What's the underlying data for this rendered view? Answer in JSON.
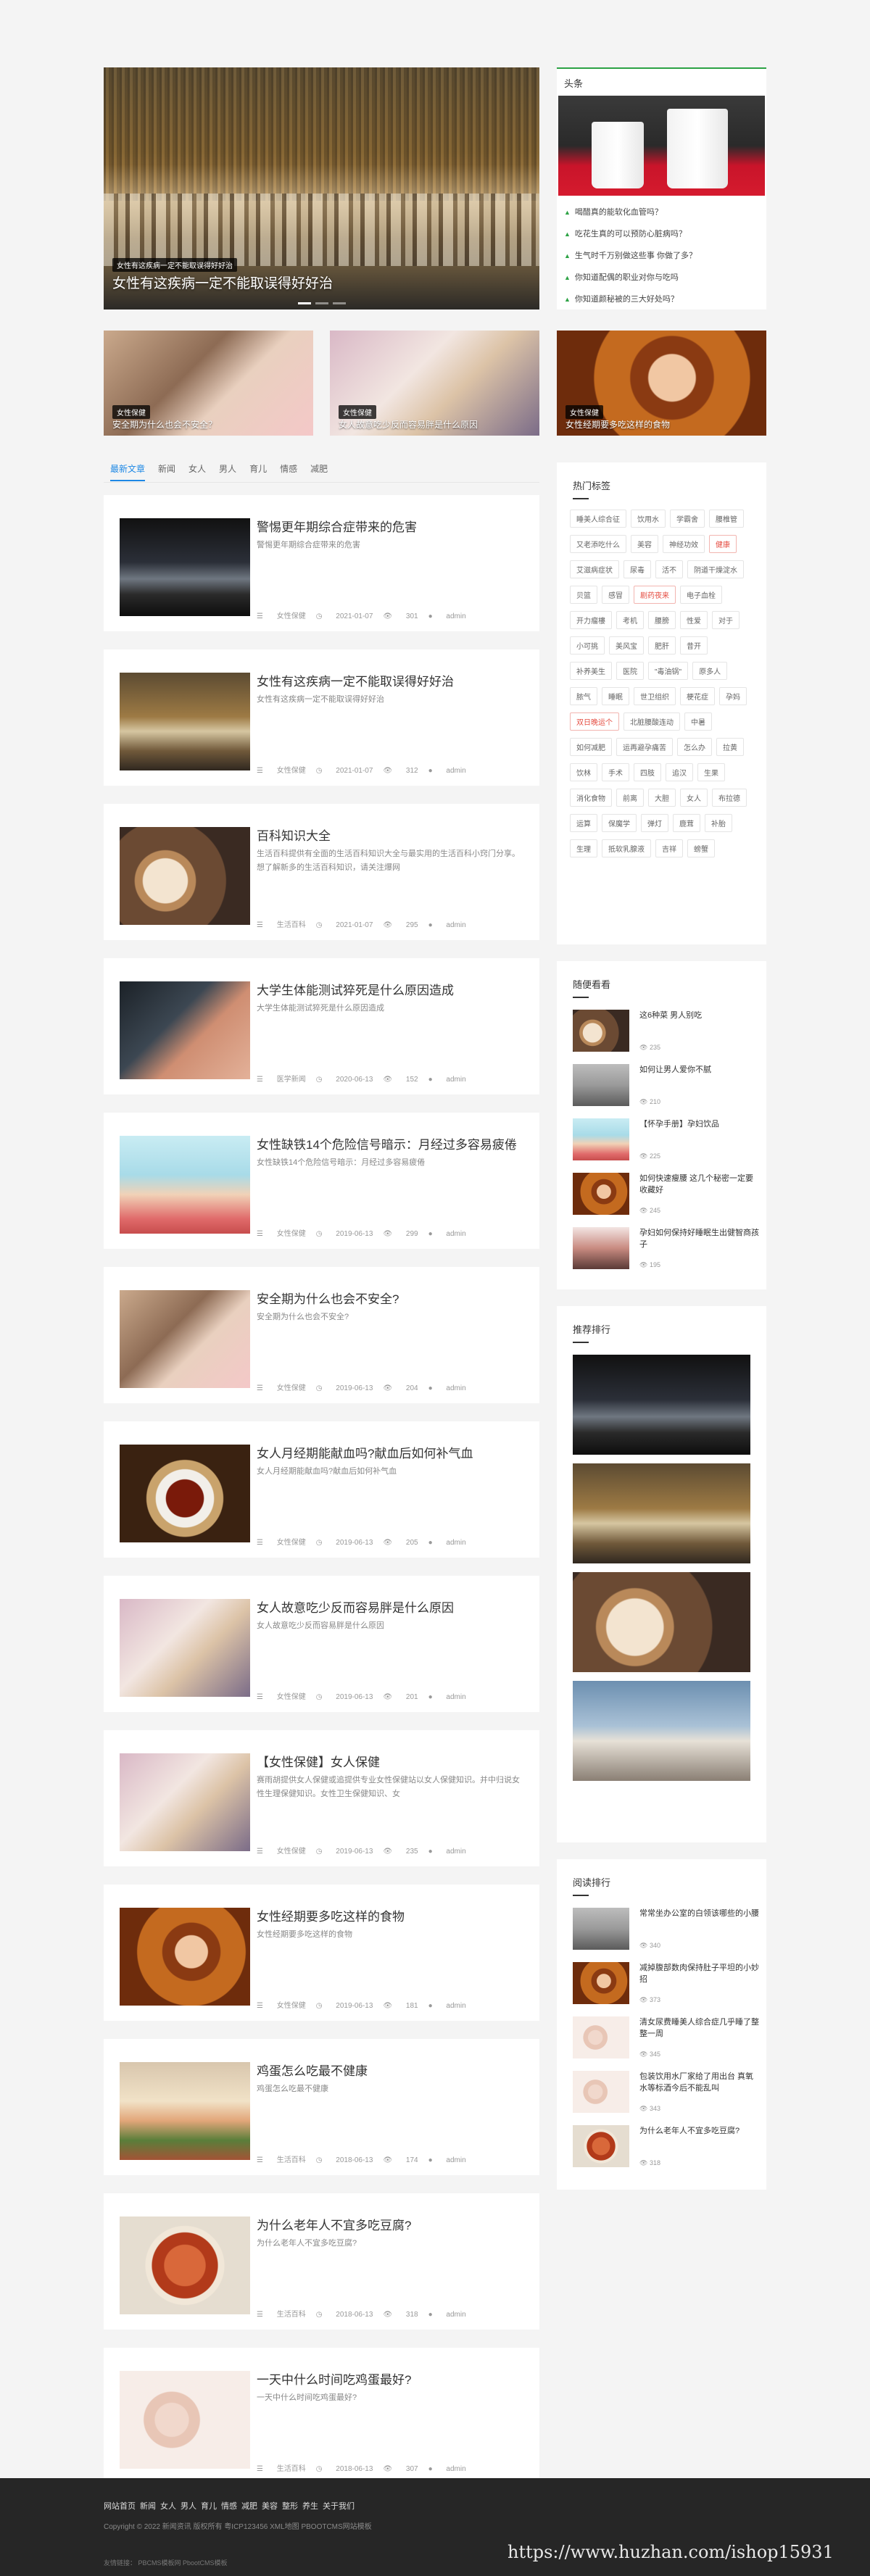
{
  "hero": {
    "tag": "女性有这疾病一定不能取误得好好治",
    "title": "女性有这疾病一定不能取误得好好治",
    "dots": 3
  },
  "headlines": {
    "title": "头条",
    "items": [
      "喝醋真的能软化血管吗？",
      "吃花生真的可以预防心脏病吗？",
      "生气时千万别做这些事 你做了多？",
      "你知道配偶的职业对你与吃吗",
      "你知道颜秘被的三大好处吗？"
    ]
  },
  "featured": [
    {
      "tag": "女性保健",
      "caption": "安全期为什么也会不安全？"
    },
    {
      "tag": "女性保健",
      "caption": "女人故意吃少反而容易胖是什么原因"
    },
    {
      "tag": "女性保健",
      "caption": "女性经期要多吃这样的食物"
    }
  ],
  "tabs": [
    "最新文章",
    "新闻",
    "女人",
    "男人",
    "育儿",
    "情感",
    "减肥"
  ],
  "posts": [
    {
      "title": "警惕更年期综合症带来的危害",
      "desc": "警惕更年期综合症带来的危害",
      "cat": "女性保健",
      "date": "2021-01-07",
      "views": "301",
      "author": "admin"
    },
    {
      "title": "女性有这疾病一定不能取误得好好治",
      "desc": "女性有这疾病一定不能取误得好好治",
      "cat": "女性保健",
      "date": "2021-01-07",
      "views": "312",
      "author": "admin"
    },
    {
      "title": "百科知识大全",
      "desc": "生活百科提供有全面的生活百科知识大全与最实用的生活百科小窍门分享。想了解新多的生活百科知识，请关注爆网",
      "cat": "生活百科",
      "date": "2021-01-07",
      "views": "295",
      "author": "admin"
    },
    {
      "title": "大学生体能测试猝死是什么原因造成",
      "desc": "大学生体能测试猝死是什么原因造成",
      "cat": "医学新闻",
      "date": "2020-06-13",
      "views": "152",
      "author": "admin"
    },
    {
      "title": "女性缺铁14个危险信号暗示：月经过多容易疲倦",
      "desc": "女性缺铁14个危险信号暗示：月经过多容易疲倦",
      "cat": "女性保健",
      "date": "2019-06-13",
      "views": "299",
      "author": "admin"
    },
    {
      "title": "安全期为什么也会不安全?",
      "desc": "安全期为什么也会不安全?",
      "cat": "女性保健",
      "date": "2019-06-13",
      "views": "204",
      "author": "admin"
    },
    {
      "title": "女人月经期能献血吗?献血后如何补气血",
      "desc": "女人月经期能献血吗?献血后如何补气血",
      "cat": "女性保健",
      "date": "2019-06-13",
      "views": "205",
      "author": "admin"
    },
    {
      "title": "女人故意吃少反而容易胖是什么原因",
      "desc": "女人故意吃少反而容易胖是什么原因",
      "cat": "女性保健",
      "date": "2019-06-13",
      "views": "201",
      "author": "admin"
    },
    {
      "title": "【女性保健】女人保健",
      "desc": "赛雨胡提供女人保健或追提供专业女性保健站以女人保健知识。并中归说女性生理保健知识。女性卫生保健知识、女",
      "cat": "女性保健",
      "date": "2019-06-13",
      "views": "235",
      "author": "admin"
    },
    {
      "title": "女性经期要多吃这样的食物",
      "desc": "女性经期要多吃这样的食物",
      "cat": "女性保健",
      "date": "2019-06-13",
      "views": "181",
      "author": "admin"
    },
    {
      "title": "鸡蛋怎么吃最不健康",
      "desc": "鸡蛋怎么吃最不健康",
      "cat": "生活百科",
      "date": "2018-06-13",
      "views": "174",
      "author": "admin"
    },
    {
      "title": "为什么老年人不宜多吃豆腐?",
      "desc": "为什么老年人不宜多吃豆腐?",
      "cat": "生活百科",
      "date": "2018-06-13",
      "views": "318",
      "author": "admin"
    },
    {
      "title": "一天中什么时间吃鸡蛋最好?",
      "desc": "一天中什么时间吃鸡蛋最好?",
      "cat": "生活百科",
      "date": "2018-06-13",
      "views": "307",
      "author": "admin"
    }
  ],
  "hot_tags": {
    "title": "热门标签",
    "tags": [
      {
        "t": "睡美人综合征"
      },
      {
        "t": "饮用水"
      },
      {
        "t": "学霸舍"
      },
      {
        "t": "腰椎管"
      },
      {
        "t": "又老添吃什么"
      },
      {
        "t": "美容"
      },
      {
        "t": "神经功效"
      },
      {
        "t": "健康",
        "red": true
      },
      {
        "t": "艾滋病症状"
      },
      {
        "t": "尿毒"
      },
      {
        "t": "活不"
      },
      {
        "t": "阴道干燥淀水"
      },
      {
        "t": "贝篮"
      },
      {
        "t": "感冒"
      },
      {
        "t": "剧药夜来",
        "red": true
      },
      {
        "t": "电子血栓"
      },
      {
        "t": "开力瘤樓"
      },
      {
        "t": "考机"
      },
      {
        "t": "腰膀"
      },
      {
        "t": "性爱"
      },
      {
        "t": "对于"
      },
      {
        "t": "小可挑"
      },
      {
        "t": "美风宝"
      },
      {
        "t": "肥肝"
      },
      {
        "t": "昔开"
      },
      {
        "t": "补养美生"
      },
      {
        "t": "医院"
      },
      {
        "t": "\"毒油锅\""
      },
      {
        "t": "原多人"
      },
      {
        "t": "脓气"
      },
      {
        "t": "睡眠"
      },
      {
        "t": "世卫组织"
      },
      {
        "t": "梗花症"
      },
      {
        "t": "孕妈"
      },
      {
        "t": "双日晚运个",
        "red": true
      },
      {
        "t": "北脏腰酸连动"
      },
      {
        "t": "中暑"
      },
      {
        "t": "如何减肥"
      },
      {
        "t": "运再避孕痛苦"
      },
      {
        "t": "怎么办"
      },
      {
        "t": "拉黄"
      },
      {
        "t": "饮林"
      },
      {
        "t": "手术"
      },
      {
        "t": "四肢"
      },
      {
        "t": "追汉"
      },
      {
        "t": "生果"
      },
      {
        "t": "消化食物"
      },
      {
        "t": "前离"
      },
      {
        "t": "大胆"
      },
      {
        "t": "女人"
      },
      {
        "t": "布拉德"
      },
      {
        "t": "运算"
      },
      {
        "t": "保魔学"
      },
      {
        "t": "弹灯"
      },
      {
        "t": "鹿茸"
      },
      {
        "t": "补胎"
      },
      {
        "t": "生理"
      },
      {
        "t": "抵软乳腺液"
      },
      {
        "t": "吉祥"
      },
      {
        "t": "螃蟹"
      }
    ]
  },
  "random": {
    "title": "随便看看",
    "items": [
      {
        "title": "这6种菜 男人别吃",
        "views": "235"
      },
      {
        "title": "如何让男人爱你不腻",
        "views": "210"
      },
      {
        "title": "【怀孕手册】孕妇饮品",
        "views": "225"
      },
      {
        "title": "如何快速瘦腰 这几个秘密一定要收藏好",
        "views": "245"
      },
      {
        "title": "孕妇如何保持好睡眠生出健智商孩子",
        "views": "195"
      }
    ]
  },
  "recommend": {
    "title": "推荐排行"
  },
  "reading": {
    "title": "阅读排行",
    "items": [
      {
        "title": "常常坐办公室的白领该哪些的小腰",
        "views": "340"
      },
      {
        "title": "减掉腹部数肉保持肚子平坦的小妙招",
        "views": "373"
      },
      {
        "title": "清女尿费睡美人综合症几乎睡了整整一周",
        "views": "345"
      },
      {
        "title": "包装饮用水厂家给了用出台 真氧水等标酒今后不能乱叫",
        "views": "343"
      },
      {
        "title": "为什么老年人不宜多吃豆腐?",
        "views": "318"
      }
    ]
  },
  "footer": {
    "nav": [
      "网站首页",
      "新闻",
      "女人",
      "男人",
      "育儿",
      "情感",
      "减肥",
      "美容",
      "整形",
      "养生",
      "关于我们"
    ],
    "copyright": "Copyright © 2022 新闻资讯 版权所有 粤ICP123456 XML地图 PBOOTCMS网站模板",
    "links": "友情链接：  PBCMS模板网  PbootCMS模板",
    "watermark": "https://www.huzhan.com/ishop15931"
  }
}
